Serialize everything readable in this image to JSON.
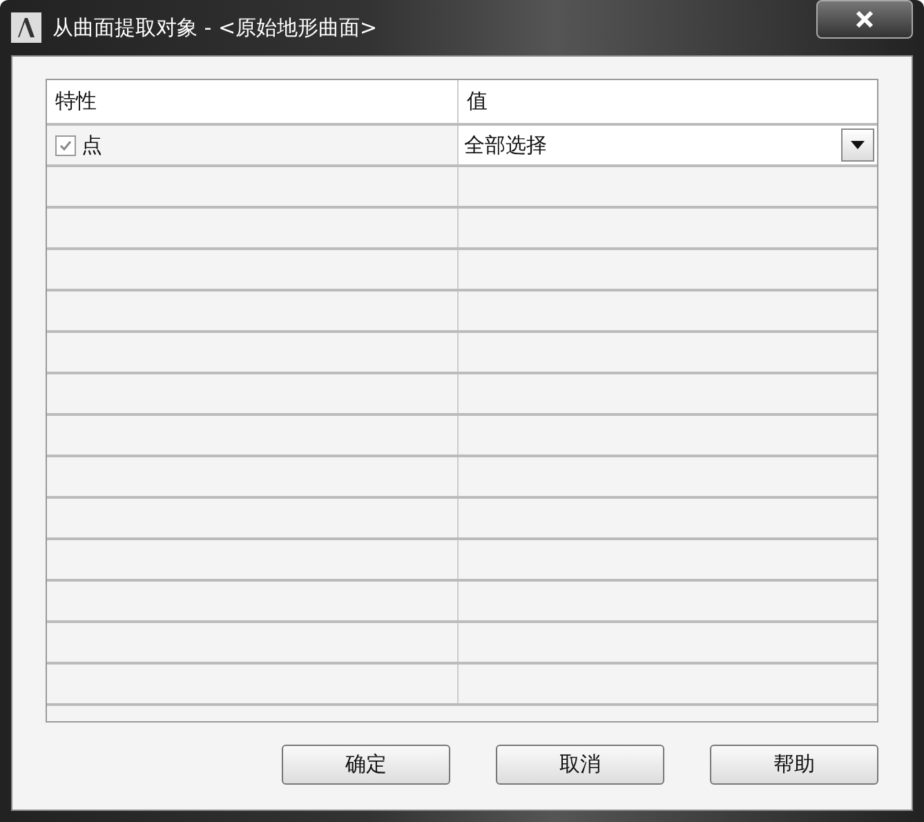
{
  "window": {
    "title": "从曲面提取对象 - <原始地形曲面>"
  },
  "table": {
    "columns": [
      "特性",
      "值"
    ],
    "rows": [
      {
        "label": "点",
        "checked": true,
        "value": "全部选择"
      }
    ]
  },
  "buttons": [
    "确定",
    "取消",
    "帮助"
  ]
}
